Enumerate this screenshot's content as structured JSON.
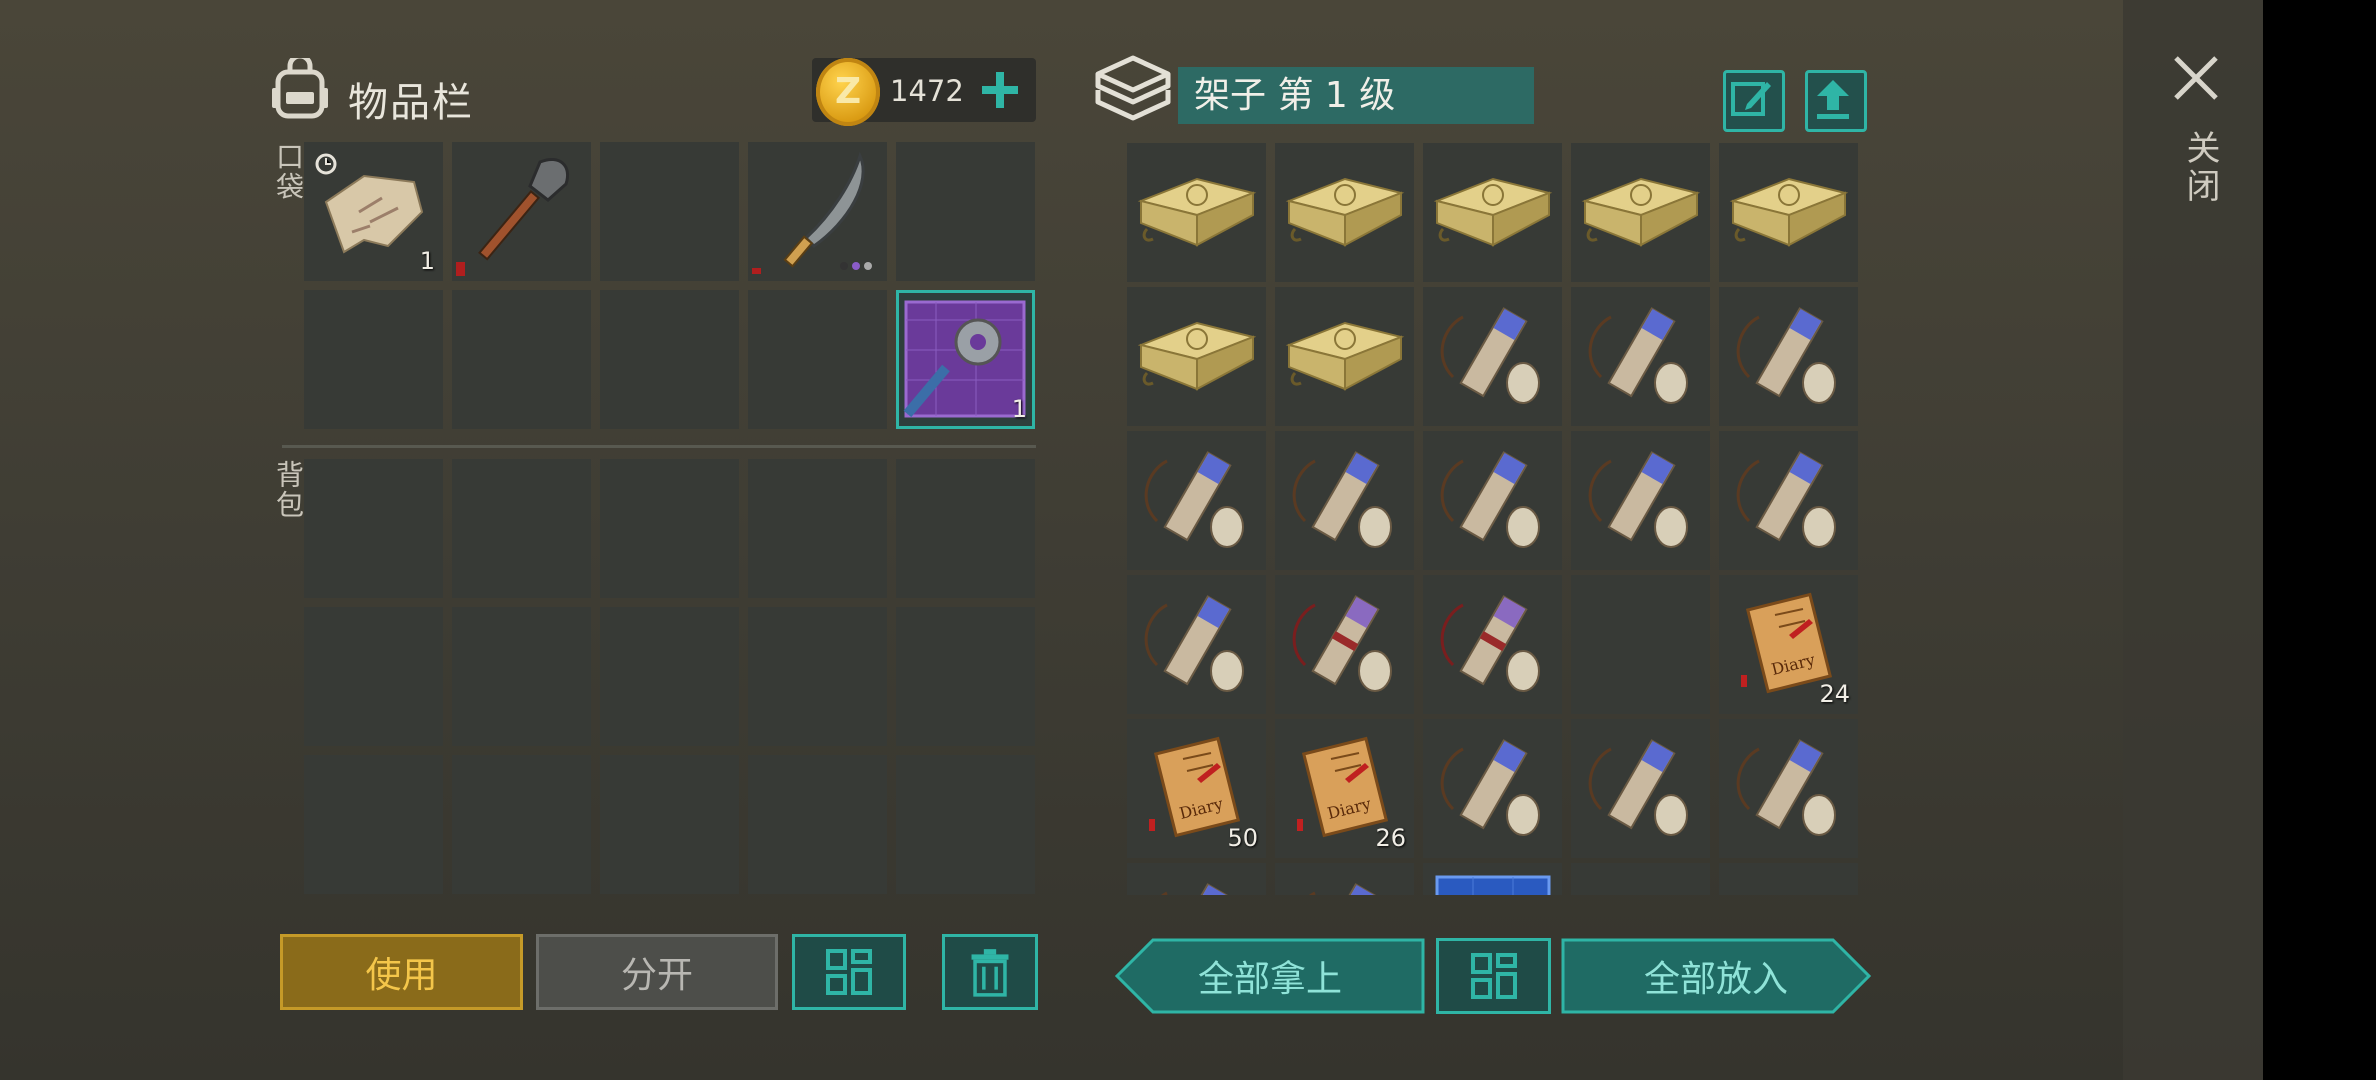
{
  "inventory": {
    "title": "物品栏",
    "coins": "1472",
    "pocket_label": "口袋",
    "backpack_label": "背包",
    "pocket_slots": [
      {
        "item": "map-fragment",
        "count": "1"
      },
      {
        "item": "shovel",
        "count": ""
      },
      {
        "item": "empty",
        "count": ""
      },
      {
        "item": "machete",
        "count": ""
      },
      {
        "item": "empty",
        "count": ""
      },
      {
        "item": "empty",
        "count": ""
      },
      {
        "item": "empty",
        "count": ""
      },
      {
        "item": "empty",
        "count": ""
      },
      {
        "item": "empty",
        "count": ""
      },
      {
        "item": "mace-blueprint",
        "count": "1"
      }
    ]
  },
  "shelf": {
    "title": "架子 第 1 级",
    "slots": [
      {
        "item": "bread-crate",
        "count": ""
      },
      {
        "item": "bread-crate",
        "count": ""
      },
      {
        "item": "bread-crate",
        "count": ""
      },
      {
        "item": "bread-crate",
        "count": ""
      },
      {
        "item": "bread-crate",
        "count": ""
      },
      {
        "item": "bread-crate",
        "count": ""
      },
      {
        "item": "bread-crate",
        "count": ""
      },
      {
        "item": "blue-scroll",
        "count": ""
      },
      {
        "item": "blue-scroll",
        "count": ""
      },
      {
        "item": "blue-scroll",
        "count": ""
      },
      {
        "item": "blue-scroll",
        "count": ""
      },
      {
        "item": "blue-scroll",
        "count": ""
      },
      {
        "item": "blue-scroll",
        "count": ""
      },
      {
        "item": "blue-scroll",
        "count": ""
      },
      {
        "item": "blue-scroll",
        "count": ""
      },
      {
        "item": "blue-scroll",
        "count": ""
      },
      {
        "item": "red-scroll",
        "count": ""
      },
      {
        "item": "red-scroll",
        "count": ""
      },
      {
        "item": "empty",
        "count": ""
      },
      {
        "item": "diary",
        "count": "24"
      },
      {
        "item": "diary",
        "count": "50"
      },
      {
        "item": "diary",
        "count": "26"
      },
      {
        "item": "blue-scroll",
        "count": ""
      },
      {
        "item": "blue-scroll",
        "count": ""
      },
      {
        "item": "blue-scroll",
        "count": ""
      },
      {
        "item": "blue-scroll",
        "count": ""
      },
      {
        "item": "blue-scroll",
        "count": ""
      },
      {
        "item": "blue-blueprint",
        "count": ""
      },
      {
        "item": "empty",
        "count": ""
      },
      {
        "item": "empty",
        "count": ""
      }
    ]
  },
  "buttons": {
    "use": "使用",
    "split": "分开",
    "take_all": "全部拿上",
    "put_all": "全部放入"
  },
  "close_label": "关闭",
  "colors": {
    "accent": "#2fb5a6",
    "use_button": "#8a6b1a",
    "coin": "#e3a91c"
  }
}
